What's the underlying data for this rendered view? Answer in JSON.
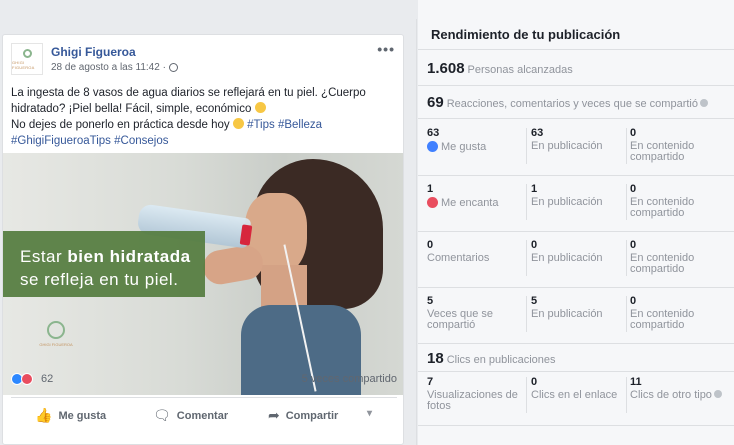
{
  "post": {
    "author": "Ghigi Figueroa",
    "date": "28 de agosto a las 11:42 ·",
    "avatar_text": "GHIGI FIGUEROA",
    "text_line1": "La ingesta de 8 vasos de agua diarios se reflejará en tu piel. ¿Cuerpo",
    "text_line2": "hidratado? ¡Piel bella! Fácil, simple, económico",
    "text_line3": "No dejes de ponerlo en práctica desde hoy",
    "tag1": "#Tips",
    "tag2": "#Belleza",
    "tag3": "#GhigiFigueroaTips",
    "tag4": "#Consejos",
    "image_text_1a": "Estar ",
    "image_text_1b": "bien hidratada",
    "image_text_2": "se refleja en tu piel.",
    "image_logo_text": "GHIGI FIGUEROA",
    "reaction_count": "62",
    "shares": "5 veces compartido",
    "actions": {
      "like": "Me gusta",
      "comment": "Comentar",
      "share": "Compartir"
    }
  },
  "panel": {
    "title": "Rendimiento de tu publicación",
    "reach_value": "1.608",
    "reach_label": "Personas alcanzadas",
    "engagement_value": "69",
    "engagement_label": "Reacciones, comentarios y veces que se compartió",
    "rows": [
      {
        "c1_num": "63",
        "c1_lab": "Me gusta",
        "c2_num": "63",
        "c2_lab": "En publicación",
        "c3_num": "0",
        "c3_lab": "En contenido compartido"
      },
      {
        "c1_num": "1",
        "c1_lab": "Me encanta",
        "c2_num": "1",
        "c2_lab": "En publicación",
        "c3_num": "0",
        "c3_lab": "En contenido compartido"
      },
      {
        "c1_num": "0",
        "c1_lab": "Comentarios",
        "c2_num": "0",
        "c2_lab": "En publicación",
        "c3_num": "0",
        "c3_lab": "En contenido compartido"
      },
      {
        "c1_num": "5",
        "c1_lab": "Veces que se compartió",
        "c2_num": "5",
        "c2_lab": "En publicación",
        "c3_num": "0",
        "c3_lab": "En contenido compartido"
      }
    ],
    "clicks_value": "18",
    "clicks_label": "Clics en publicaciones",
    "clicks_row": {
      "c1_num": "7",
      "c1_lab": "Visualizaciones de fotos",
      "c2_num": "0",
      "c2_lab": "Clics en el enlace",
      "c3_num": "11",
      "c3_lab": "Clics de otro tipo"
    }
  },
  "colors": {
    "link": "#365899",
    "like_blue": "#4080ff",
    "love_red": "#e94d5f",
    "overlay_green": "#547c3e"
  }
}
